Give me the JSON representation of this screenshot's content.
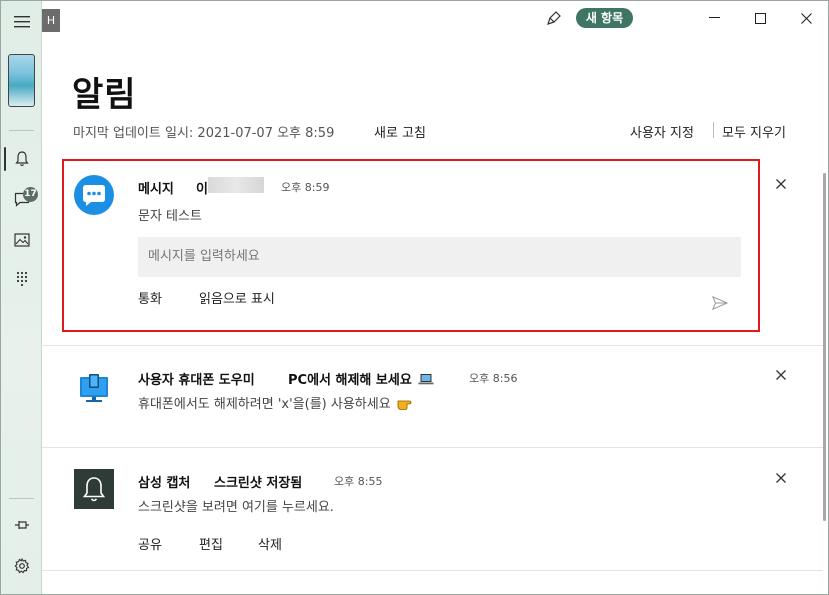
{
  "window": {
    "app_letter": "H",
    "new_items_label": "새 항목"
  },
  "rail": {
    "messages_badge": "17"
  },
  "header": {
    "title": "알림",
    "last_update": "마지막 업데이트 일시: 2021-07-07 오후 8:59",
    "refresh": "새로 고침",
    "customize": "사용자 지정",
    "clear_all": "모두 지우기"
  },
  "notifications": [
    {
      "app": "메시지",
      "sender": "이",
      "time": "오후 8:59",
      "body": "문자 테스트",
      "reply_placeholder": "메시지를 입력하세요",
      "actions": [
        "통화",
        "읽음으로 표시"
      ]
    },
    {
      "app": "사용자 휴대폰 도우미",
      "title": "PC에서 해제해 보세요",
      "time": "오후 8:56",
      "body": "휴대폰에서도 해제하려면 'x'을(를) 사용하세요"
    },
    {
      "app": "삼성 캡처",
      "title": "스크린샷 저장됨",
      "time": "오후 8:55",
      "body": "스크린샷을 보려면 여기를 누르세요.",
      "actions": [
        "공유",
        "편집",
        "삭제"
      ]
    }
  ],
  "colors": {
    "accent": "#3f7564",
    "messages_icon": "#1a8fe3",
    "focus_border": "#e0191f"
  }
}
